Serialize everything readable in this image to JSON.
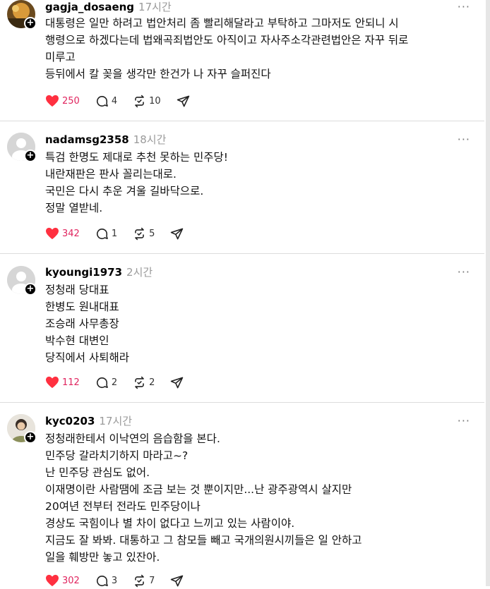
{
  "accent_like_color": "#ff3040",
  "posts": [
    {
      "username": "gagja_dosaeng",
      "time": "17시간",
      "more_label": "···",
      "lines": [
        "대통령은 일만 하려고 법안처리 좀 빨리해달라고 부탁하고 그마저도 안되니 시",
        "행령으로 하겠다는데 법왜곡죄법안도 아직이고 자사주소각관련법안은 자꾸 뒤로",
        "미루고",
        "등뒤에서 칼 꽂을 생각만 한건가 나 자꾸 슬퍼진다"
      ],
      "likes": "250",
      "comments": "4",
      "reposts": "10",
      "avatar_icon": "profile-photo"
    },
    {
      "username": "nadamsg2358",
      "time": "18시간",
      "more_label": "···",
      "lines": [
        "특검 한명도 제대로 추천 못하는 민주당!",
        "내란재판은 판사 꼴리는대로.",
        "국민은 다시 추운 겨울 길바닥으로.",
        "정말 열받네."
      ],
      "likes": "342",
      "comments": "1",
      "reposts": "5",
      "avatar_icon": "default-user"
    },
    {
      "username": "kyoungi1973",
      "time": "2시간",
      "more_label": "···",
      "lines": [
        "정청래 당대표",
        "한병도 원내대표",
        "조승래 사무총장",
        "박수현 대변인",
        "당직에서 사퇴해라"
      ],
      "likes": "112",
      "comments": "2",
      "reposts": "2",
      "avatar_icon": "default-user"
    },
    {
      "username": "kyc0203",
      "time": "17시간",
      "more_label": "···",
      "lines": [
        "정청래한테서 이낙연의 음습함을 본다.",
        "민주당 갈라치기하지 마라고~?",
        "난 민주당 관심도 없어.",
        "이재명이란 사람땜에 조금 보는 것 뿐이지만...난 광주광역시 살지만",
        "20여년 전부터 전라도 민주당이나",
        "경상도 국힘이나 별 차이 없다고 느끼고 있는 사람이야.",
        "지금도 잘 봐봐. 대통하고 그 참모들 빼고 국개의원시끼들은 일 안하고",
        "일을 훼방만 놓고 있잔아."
      ],
      "likes": "302",
      "comments": "3",
      "reposts": "7",
      "avatar_icon": "profile-photo"
    }
  ]
}
